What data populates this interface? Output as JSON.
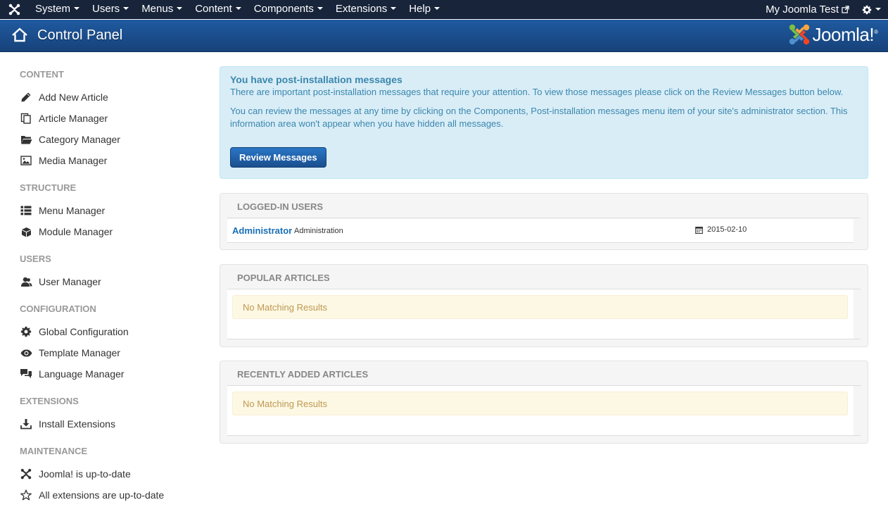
{
  "topbar": {
    "menu": [
      {
        "label": "System"
      },
      {
        "label": "Users"
      },
      {
        "label": "Menus"
      },
      {
        "label": "Content"
      },
      {
        "label": "Components"
      },
      {
        "label": "Extensions"
      },
      {
        "label": "Help"
      }
    ],
    "site_label": "My Joomla Test"
  },
  "header": {
    "title": "Control Panel",
    "brand": "Joomla!",
    "brand_reg": "®"
  },
  "sidebar": {
    "sections": [
      {
        "heading": "CONTENT",
        "items": [
          {
            "label": "Add New Article",
            "icon": "pencil-icon"
          },
          {
            "label": "Article Manager",
            "icon": "stack-icon"
          },
          {
            "label": "Category Manager",
            "icon": "folder-icon"
          },
          {
            "label": "Media Manager",
            "icon": "image-icon"
          }
        ]
      },
      {
        "heading": "STRUCTURE",
        "items": [
          {
            "label": "Menu Manager",
            "icon": "list-icon"
          },
          {
            "label": "Module Manager",
            "icon": "cube-icon"
          }
        ]
      },
      {
        "heading": "USERS",
        "items": [
          {
            "label": "User Manager",
            "icon": "users-icon"
          }
        ]
      },
      {
        "heading": "CONFIGURATION",
        "items": [
          {
            "label": "Global Configuration",
            "icon": "cog-icon"
          },
          {
            "label": "Template Manager",
            "icon": "eye-icon"
          },
          {
            "label": "Language Manager",
            "icon": "comments-icon"
          }
        ]
      },
      {
        "heading": "EXTENSIONS",
        "items": [
          {
            "label": "Install Extensions",
            "icon": "download-icon"
          }
        ]
      },
      {
        "heading": "MAINTENANCE",
        "items": [
          {
            "label": "Joomla! is up-to-date",
            "icon": "joomla-icon"
          },
          {
            "label": "All extensions are up-to-date",
            "icon": "star-icon"
          }
        ]
      }
    ]
  },
  "alert": {
    "heading": "You have post-installation messages",
    "text1": "There are important post-installation messages that require your attention. To view those messages please click on the Review Messages button below.",
    "text2": "You can review the messages at any time by clicking on the Components, Post-installation messages menu item of your site's administrator section. This information area won't appear when you have hidden all messages.",
    "button": "Review Messages"
  },
  "logged_in": {
    "heading": "LOGGED-IN USERS",
    "user": "Administrator",
    "role": "Administration",
    "date": "2015-02-10"
  },
  "popular": {
    "heading": "POPULAR ARTICLES",
    "empty": "No Matching Results"
  },
  "recent": {
    "heading": "RECENTLY ADDED ARTICLES",
    "empty": "No Matching Results"
  },
  "colors": {
    "navbar": "#17243a",
    "header": "#1f5aa0",
    "alert_bg": "#d9edf7",
    "alert_text": "#3a87ad",
    "warning_bg": "#fcf8e3",
    "warning_text": "#c09853",
    "link": "#1a6fb5"
  }
}
